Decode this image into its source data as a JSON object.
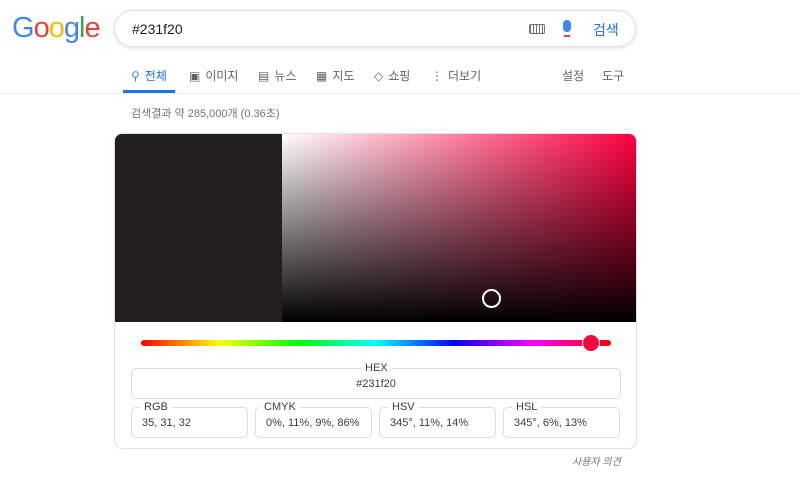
{
  "logo": "Google",
  "search": {
    "query": "#231f20",
    "button": "검색"
  },
  "tabs": [
    {
      "label": "전체",
      "icon": "search-icon"
    },
    {
      "label": "이미지",
      "icon": "image-icon"
    },
    {
      "label": "뉴스",
      "icon": "news-icon"
    },
    {
      "label": "지도",
      "icon": "map-icon"
    },
    {
      "label": "쇼핑",
      "icon": "tag-icon"
    },
    {
      "label": "더보기",
      "icon": "more-vert-icon"
    }
  ],
  "tools": {
    "settings": "설정",
    "tools": "도구"
  },
  "stats": "검색결과 약 285,000개 (0.36초)",
  "picker": {
    "color": "#231f20",
    "hue_color": "#ff0040",
    "hue_degrees": 345,
    "hex": {
      "label": "HEX",
      "value": "#231f20"
    },
    "rgb": {
      "label": "RGB",
      "value": "35, 31, 32"
    },
    "cmyk": {
      "label": "CMYK",
      "value": "0%, 11%, 9%, 86%"
    },
    "hsv": {
      "label": "HSV",
      "value": "345°, 11%, 14%"
    },
    "hsl": {
      "label": "HSL",
      "value": "345°, 6%, 13%"
    }
  },
  "feedback": "사용자 의견"
}
